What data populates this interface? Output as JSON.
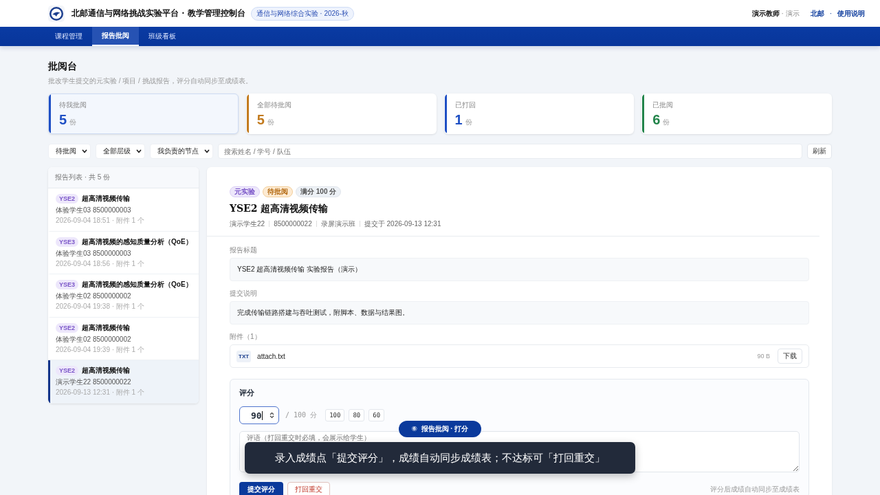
{
  "header": {
    "title": "北邮通信与网络挑战实验平台 · 教学管理控制台",
    "course_badge": "通信与网络综合实验 · 2026-秋",
    "user_name": "演示教师",
    "user_role": "· 演示",
    "org": "北邮",
    "sep": "·",
    "help": "使用说明"
  },
  "tabs": [
    {
      "label": "课程管理",
      "selected": false
    },
    {
      "label": "报告批阅",
      "selected": true
    },
    {
      "label": "班级看板",
      "selected": false
    }
  ],
  "page": {
    "title": "批阅台",
    "subtitle": "批改学生提交的元实验 / 项目 / 挑战报告，评分自动同步至成绩表。"
  },
  "stats": [
    {
      "label": "待我批阅",
      "value": "5",
      "unit": "份",
      "color": "#1e4fc4",
      "selected": true
    },
    {
      "label": "全部待批阅",
      "value": "5",
      "unit": "份",
      "color": "#c27a1e",
      "selected": false
    },
    {
      "label": "已打回",
      "value": "1",
      "unit": "份",
      "color": "#1e4fc4",
      "selected": false
    },
    {
      "label": "已批阅",
      "value": "6",
      "unit": "份",
      "color": "#22844a",
      "selected": false
    }
  ],
  "filters": {
    "selects": [
      "待批阅",
      "全部层级",
      "我负责的节点"
    ],
    "search_placeholder": "搜索姓名 / 学号 / 队伍",
    "refresh": "刷新"
  },
  "report_list": {
    "heading": "报告列表 · 共 5 份",
    "items": [
      {
        "tag": "YSE2",
        "title": "超高清视频传输",
        "student": "体验学生03 8500000003",
        "meta": "2026-09-04 18:51 · 附件 1 个",
        "selected": false
      },
      {
        "tag": "YSE3",
        "title": "超高清视频的感知质量分析（QoE）",
        "student": "体验学生03 8500000003",
        "meta": "2026-09-04 18:56 · 附件 1 个",
        "selected": false
      },
      {
        "tag": "YSE3",
        "title": "超高清视频的感知质量分析（QoE）",
        "student": "体验学生02 8500000002",
        "meta": "2026-09-04 19:38 · 附件 1 个",
        "selected": false
      },
      {
        "tag": "YSE2",
        "title": "超高清视频传输",
        "student": "体验学生02 8500000002",
        "meta": "2026-09-04 19:39 · 附件 1 个",
        "selected": false
      },
      {
        "tag": "YSE2",
        "title": "超高清视频传输",
        "student": "演示学生22 8500000022",
        "meta": "2026-09-13 12:31 · 附件 1 个",
        "selected": true
      }
    ]
  },
  "detail": {
    "tags": [
      {
        "label": "元实验",
        "color": "#ede7fb"
      },
      {
        "label": "待批阅",
        "color": "#fdebd3"
      },
      {
        "label": "满分 100 分",
        "color": "#edf1f6"
      }
    ],
    "title": "YSE2 超高清视频传输",
    "meta": [
      "演示学生22",
      "8500000022",
      "录屏演示班",
      "提交于 2026-09-13 12:31"
    ],
    "report_title_label": "报告标题",
    "report_title": "YSE2 超高清视频传输 实验报告（演示）",
    "note_label": "提交说明",
    "note": "完成传输链路搭建与吞吐测试，附脚本、数据与结果图。",
    "attachments_label": "附件（1）",
    "attachment": {
      "type": "TXT",
      "name": "attach.txt",
      "size": "90 B",
      "download": "下载"
    },
    "grading": {
      "heading": "评分",
      "score": "90",
      "max": "/ 100 分",
      "presets": [
        "100",
        "80",
        "60"
      ],
      "comment_placeholder": "评语（打回重交时必填，会展示给学生）",
      "submit": "提交评分",
      "reject": "打回重交",
      "hint": "评分后成绩自动同步至成绩表"
    }
  },
  "overlay": {
    "step": "⑥  报告批阅 · 打分",
    "caption": "录入成绩点「提交评分」，成绩自动同步成绩表；不达标可「打回重交」"
  }
}
